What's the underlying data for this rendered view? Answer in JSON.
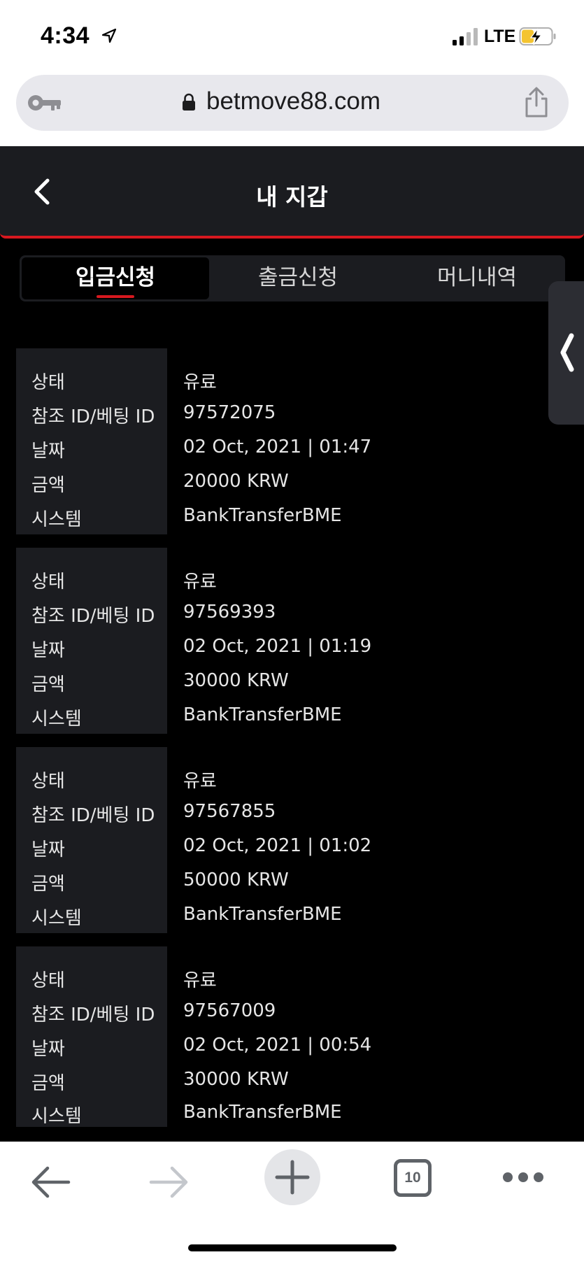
{
  "status_bar": {
    "time": "4:34",
    "network": "LTE"
  },
  "url_bar": {
    "domain": "betmove88.com"
  },
  "header": {
    "title": "내 지갑"
  },
  "tabs": [
    {
      "label": "입금신청",
      "active": true
    },
    {
      "label": "출금신청",
      "active": false
    },
    {
      "label": "머니내역",
      "active": false
    }
  ],
  "records": [
    {
      "status_label": "상태",
      "status": "유료",
      "ref_label": "참조 ID/베팅 ID",
      "ref_id": "97572075",
      "date_label": "날짜",
      "date": "02 Oct, 2021 | 01:47",
      "amount_label": "금액",
      "amount": "20000 KRW",
      "system_label": "시스템",
      "system": "BankTransferBME"
    },
    {
      "status_label": "상태",
      "status": "유료",
      "ref_label": "참조 ID/베팅 ID",
      "ref_id": "97569393",
      "date_label": "날짜",
      "date": "02 Oct, 2021 | 01:19",
      "amount_label": "금액",
      "amount": "30000 KRW",
      "system_label": "시스템",
      "system": "BankTransferBME"
    },
    {
      "status_label": "상태",
      "status": "유료",
      "ref_label": "참조 ID/베팅 ID",
      "ref_id": "97567855",
      "date_label": "날짜",
      "date": "02 Oct, 2021 | 01:02",
      "amount_label": "금액",
      "amount": "50000 KRW",
      "system_label": "시스템",
      "system": "BankTransferBME"
    },
    {
      "status_label": "상태",
      "status": "유료",
      "ref_label": "참조 ID/베팅 ID",
      "ref_id": "97567009",
      "date_label": "날짜",
      "date": "02 Oct, 2021 | 00:54",
      "amount_label": "금액",
      "amount": "30000 KRW",
      "system_label": "시스템",
      "system": "BankTransferBME"
    }
  ],
  "toolbar": {
    "tab_count": "10"
  },
  "colors": {
    "accent": "#d7181f",
    "panel": "#1b1c20",
    "background": "#000000"
  },
  "icons": [
    "location-arrow-icon",
    "signal-icon",
    "battery-charging-icon",
    "key-icon",
    "lock-icon",
    "share-icon",
    "chevron-left-icon",
    "drawer-chevron-icon",
    "arrow-back-icon",
    "arrow-forward-icon",
    "plus-icon",
    "tabs-icon",
    "more-icon"
  ]
}
